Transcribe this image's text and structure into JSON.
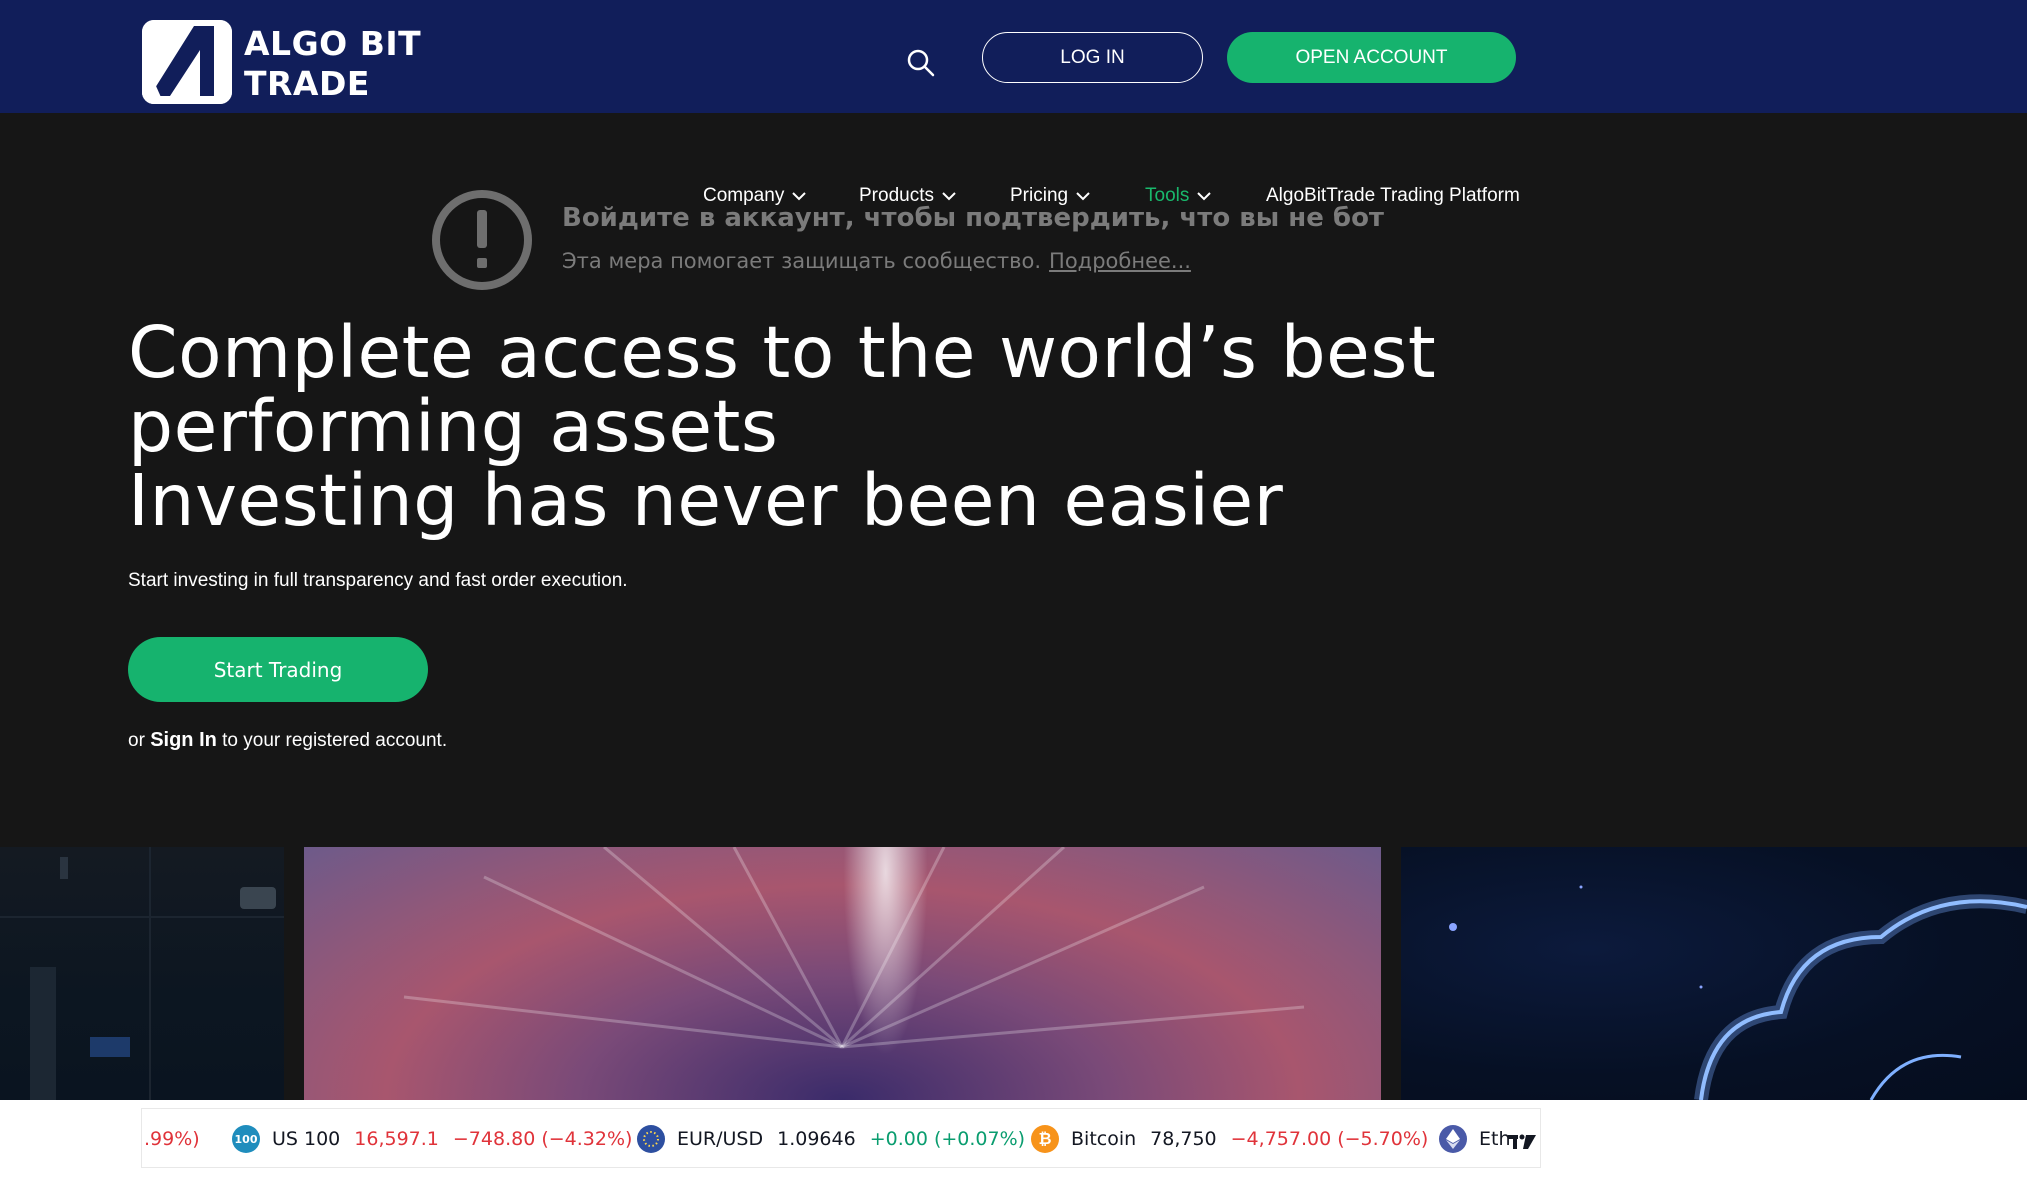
{
  "header": {
    "logo_line1": "ALGO BIT",
    "logo_line2": "TRADE",
    "login_label": "LOG IN",
    "open_account_label": "OPEN ACCOUNT",
    "background": "#111e5a",
    "accent": "#16b36e"
  },
  "nav": {
    "items": [
      {
        "label": "Company",
        "has_dropdown": true
      },
      {
        "label": "Products",
        "has_dropdown": true
      },
      {
        "label": "Pricing",
        "has_dropdown": true
      },
      {
        "label": "Tools",
        "has_dropdown": true,
        "active": true
      },
      {
        "label": "AlgoBitTrade Trading Platform",
        "has_dropdown": false
      }
    ],
    "active_color": "#19b86c"
  },
  "notice": {
    "icon": "exclamation-circle-icon",
    "title": "Войдите в аккаунт, чтобы подтвердить, что вы не бот",
    "text": "Эта мера помогает защищать сообщество.",
    "link": "Подробнее..."
  },
  "hero": {
    "title_line1": "Complete access to the world’s best",
    "title_line2": "performing assets",
    "title_line3": "Investing has never been easier",
    "subtitle": "Start investing in full transparency and fast order execution.",
    "cta_label": "Start Trading",
    "signin_prefix": "or",
    "signin_link": "Sign In",
    "signin_suffix": "to your registered account."
  },
  "ticker": {
    "items": [
      {
        "change_tail": ".99%)",
        "trend": "down"
      },
      {
        "icon_text": "100",
        "icon_color": "#1f8dbd",
        "symbol": "US 100",
        "price": "16,597.1",
        "change": "−748.80 (−4.32%)",
        "trend": "down"
      },
      {
        "icon": "eu-us-flags-icon",
        "symbol": "EUR/USD",
        "price": "1.09646",
        "change": "+0.00 (+0.07%)",
        "trend": "up"
      },
      {
        "icon": "bitcoin-icon",
        "icon_color": "#f7931a",
        "symbol": "Bitcoin",
        "price": "78,750",
        "change": "−4,757.00 (−5.70%)",
        "trend": "down"
      },
      {
        "icon": "ethereum-icon",
        "icon_color": "#4a5aa8",
        "symbol": "Eth"
      }
    ],
    "brand_mark": "TV",
    "negative_color": "#e0333a",
    "positive_color": "#0a9d6f"
  }
}
